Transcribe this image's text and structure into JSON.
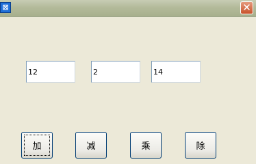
{
  "window": {
    "icon": "app-icon",
    "close_glyph": "✕"
  },
  "fields": [
    {
      "value": "12"
    },
    {
      "value": "2"
    },
    {
      "value": "14"
    }
  ],
  "buttons": {
    "add_label": "加",
    "subtract_label": "减",
    "multiply_label": "乘",
    "divide_label": "除"
  },
  "colors": {
    "window_background": "#ece9d8",
    "close_button": "#c8522a"
  }
}
